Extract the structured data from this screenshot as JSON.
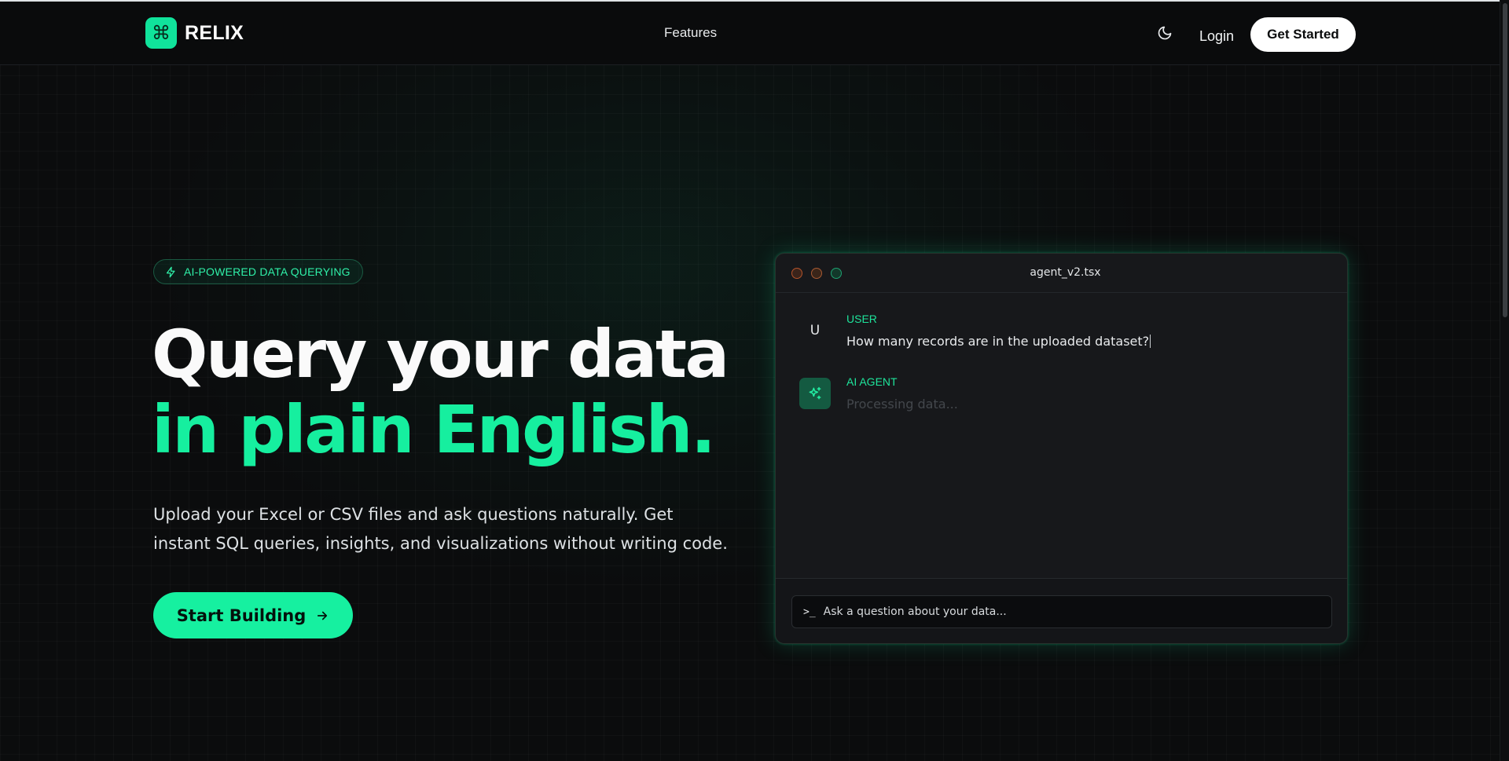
{
  "nav": {
    "brand": "RELIX",
    "logo_icon": "command-icon",
    "links": [
      "Features"
    ],
    "theme_icon": "moon-icon",
    "login_label": "Login",
    "cta_label": "Get Started"
  },
  "hero": {
    "badge": "AI-POWERED DATA QUERYING",
    "badge_icon": "zap-icon",
    "title_line1": "Query your data",
    "title_line2": "in plain English.",
    "subtitle": "Upload your Excel or CSV files and ask questions naturally. Get instant SQL queries, insights, and visualizations without writing code.",
    "cta_label": "Start Building",
    "cta_icon": "arrow-right-icon"
  },
  "terminal": {
    "filename": "agent_v2.tsx",
    "messages": [
      {
        "avatar": "U",
        "role": "USER",
        "text": "How many records are in the uploaded dataset?"
      },
      {
        "avatar_icon": "sparkles-icon",
        "role": "AI AGENT",
        "text": "Processing data..."
      }
    ],
    "input_placeholder": "Ask a question about your data..."
  },
  "colors": {
    "accent": "#16f0a0",
    "background": "#0b0c0d",
    "panel": "#17181b"
  }
}
